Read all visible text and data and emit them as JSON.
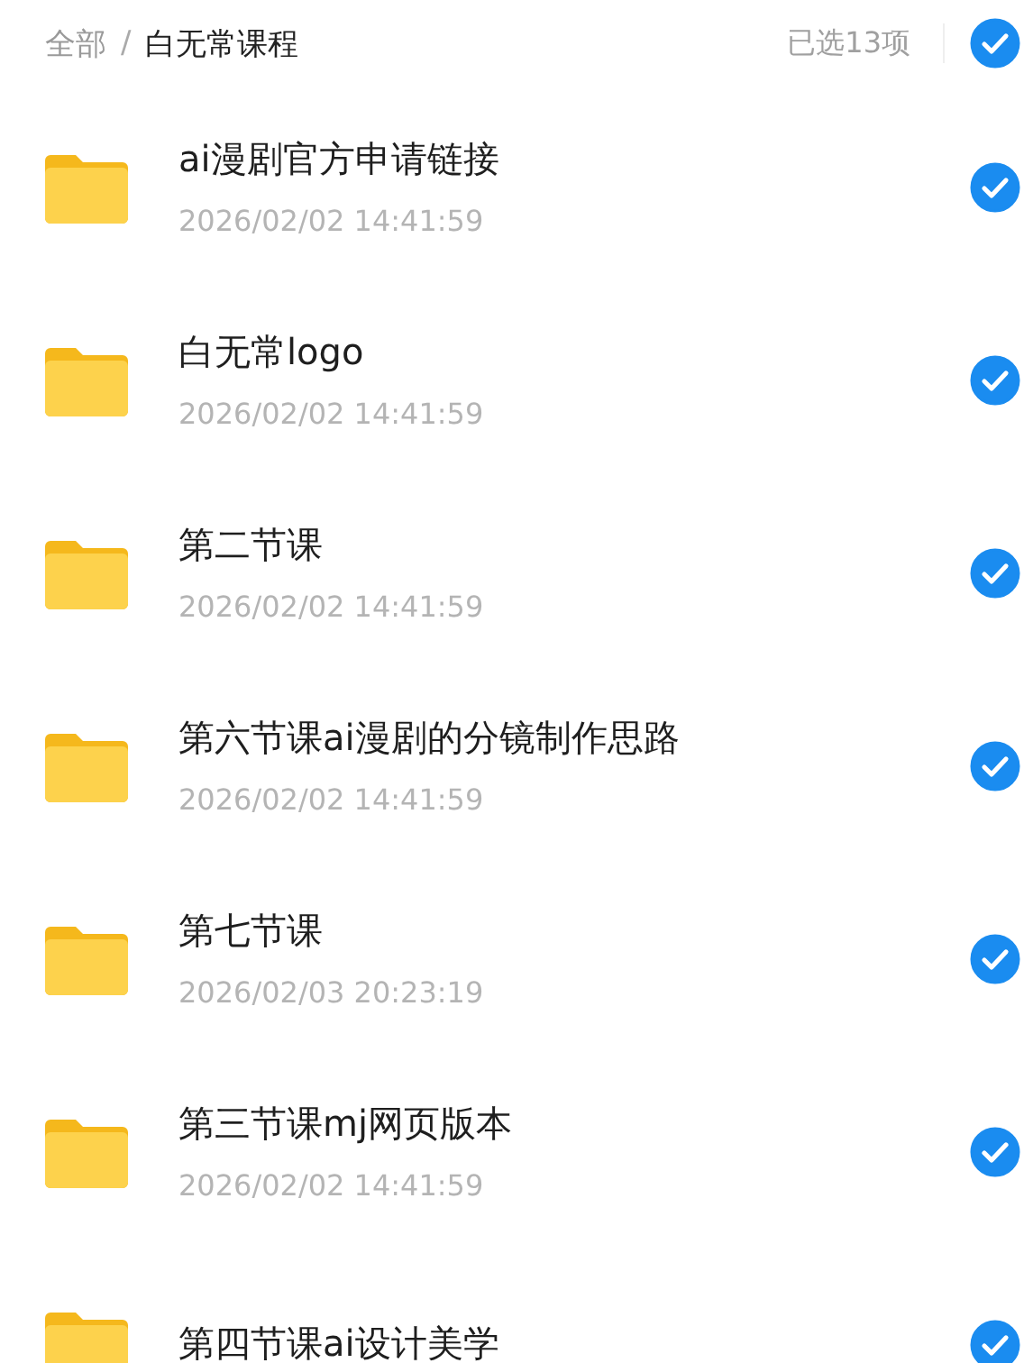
{
  "breadcrumb_separator": "/",
  "breadcrumb": [
    {
      "label": "全部",
      "current": false
    },
    {
      "label": "白无常课程",
      "current": true
    }
  ],
  "selection": {
    "count_label": "已选13项",
    "all_selected": true
  },
  "files": [
    {
      "name": "ai漫剧官方申请链接",
      "date": "2026/02/02 14:41:59",
      "selected": true
    },
    {
      "name": "白无常logo",
      "date": "2026/02/02 14:41:59",
      "selected": true
    },
    {
      "name": "第二节课",
      "date": "2026/02/02 14:41:59",
      "selected": true
    },
    {
      "name": "第六节课ai漫剧的分镜制作思路",
      "date": "2026/02/02 14:41:59",
      "selected": true
    },
    {
      "name": "第七节课",
      "date": "2026/02/03 20:23:19",
      "selected": true
    },
    {
      "name": "第三节课mj网页版本",
      "date": "2026/02/02 14:41:59",
      "selected": true
    },
    {
      "name": "第四节课ai设计美学",
      "selected": true
    }
  ]
}
